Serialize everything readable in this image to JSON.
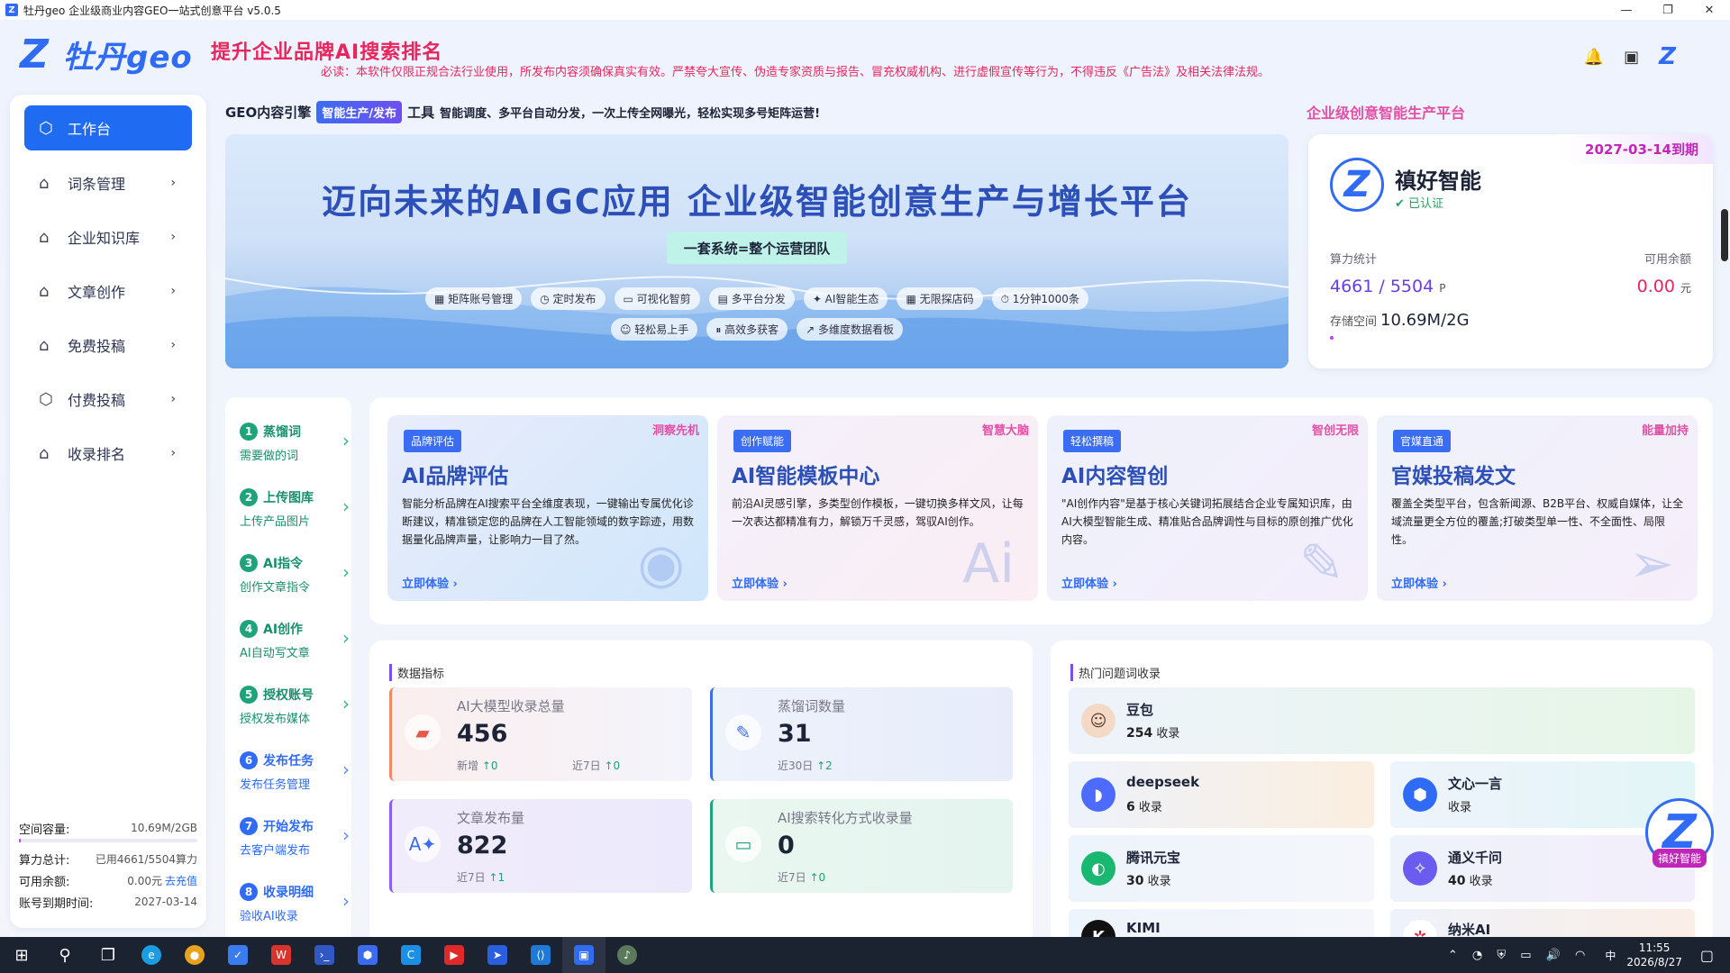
{
  "window": {
    "title": "牡丹geo 企业级商业内容GEO一站式创意平台 v5.0.5",
    "controls": [
      "—",
      "❐",
      "✕"
    ]
  },
  "header": {
    "logo_text": "牡丹geo",
    "slogan": "提升企业品牌AI搜索排名",
    "notice": "必读：本软件仅限正规合法行业使用，所发布内容须确保真实有效。严禁夸大宣传、伪造专家资质与报告、冒充权威机构、进行虚假宣传等行为，不得违反《广告法》及相关法律法规。"
  },
  "sidebar": {
    "items": [
      {
        "label": "工作台",
        "icon": "hexagon-icon"
      },
      {
        "label": "词条管理",
        "icon": "home-icon"
      },
      {
        "label": "企业知识库",
        "icon": "home-icon"
      },
      {
        "label": "文章创作",
        "icon": "home-icon"
      },
      {
        "label": "免费投稿",
        "icon": "home-icon"
      },
      {
        "label": "付费投稿",
        "icon": "hexagon-icon"
      },
      {
        "label": "收录排名",
        "icon": "home-icon"
      }
    ],
    "stats": {
      "space_label": "空间容量:",
      "space_value": "10.69M/2GB",
      "compute_label": "算力总计:",
      "compute_value": "已用4661/5504算力",
      "balance_label": "可用余额:",
      "balance_value": "0.00元",
      "recharge": "去充值",
      "expire_label": "账号到期时间:",
      "expire_value": "2027-03-14"
    }
  },
  "geo": {
    "prefix": "GEO内容引擎",
    "badge": "智能生产/发布",
    "tool": "工具",
    "desc": "智能调度、多平台自动分发，一次上传全网曝光，轻松实现多号矩阵运营!",
    "right_slogan": "企业级创意智能生产平台"
  },
  "banner": {
    "title": "迈向未来的AIGC应用  企业级智能创意生产与增长平台",
    "subtitle": "一套系统=整个运营团队",
    "chips_row1": [
      "▦ 矩阵账号管理",
      "◷ 定时发布",
      "▭ 可视化智剪",
      "▤ 多平台分发",
      "✦ AI智能生态",
      "▦ 无限探店码",
      "⏱ 1分钟1000条"
    ],
    "chips_row2": [
      "☺ 轻松易上手",
      "⏸ 高效多获客",
      "↗ 多维度数据看板"
    ]
  },
  "account": {
    "expire": "2027-03-14到期",
    "name": "禛好智能",
    "verified": "已认证",
    "compute_label": "算力统计",
    "balance_label": "可用余额",
    "compute_value": "4661 / 5504",
    "compute_unit": "P",
    "balance_value": "0.00",
    "balance_unit": "元",
    "storage_label": "存储空间",
    "storage_value": "10.69M/2G"
  },
  "steps": [
    {
      "no": "1",
      "title": "蒸馏词",
      "sub": "需要做的词"
    },
    {
      "no": "2",
      "title": "上传图库",
      "sub": "上传产品图片"
    },
    {
      "no": "3",
      "title": "AI指令",
      "sub": "创作文章指令"
    },
    {
      "no": "4",
      "title": "AI创作",
      "sub": "AI自动写文章"
    },
    {
      "no": "5",
      "title": "授权账号",
      "sub": "授权发布媒体"
    },
    {
      "no": "6",
      "title": "发布任务",
      "sub": "发布任务管理"
    },
    {
      "no": "7",
      "title": "开始发布",
      "sub": "去客户端发布"
    },
    {
      "no": "8",
      "title": "收录明细",
      "sub": "验收AI收录"
    }
  ],
  "features": [
    {
      "tag": "品牌评估",
      "corner": "洞察先机",
      "title": "AI品牌评估",
      "desc": "智能分析品牌在AI搜索平台全维度表现，一键输出专属优化诊断建议，精准锁定您的品牌在人工智能领域的数字踪迹，用数据量化品牌声量，让影响力一目了然。",
      "try": "立即体验 ›",
      "icon": "eye-icon"
    },
    {
      "tag": "创作赋能",
      "corner": "智慧大脑",
      "title": "AI智能模板中心",
      "desc": "前沿AI灵感引擎，多类型创作模板，一键切换多样文风，让每一次表达都精准有力，解锁万千灵感，驾驭AI创作。",
      "try": "立即体验 ›",
      "icon": "ai-head-icon"
    },
    {
      "tag": "轻松撰稿",
      "corner": "智创无限",
      "title": "AI内容智创",
      "desc": "\"AI创作内容\"是基于核心关键词拓展结合企业专属知识库，由AI大模型智能生成、精准贴合品牌调性与目标的原创推广优化内容。",
      "try": "立即体验 ›",
      "icon": "edit-icon"
    },
    {
      "tag": "官媒直通",
      "corner": "能量加持",
      "title": "官媒投稿发文",
      "desc": "覆盖全类型平台，包含新闻源、B2B平台、权威自媒体，让全域流量更全方位的覆盖;打破类型单一性、不全面性、局限性。",
      "try": "立即体验 ›",
      "icon": "send-icon"
    }
  ],
  "data_panel": {
    "title": "数据指标",
    "cards": [
      {
        "label": "AI大模型收录总量",
        "value": "456",
        "sub1": "新增",
        "sub1v": "↑0",
        "sub2": "近7日",
        "sub2v": "↑0"
      },
      {
        "label": "蒸馏词数量",
        "value": "31",
        "sub1": "近30日",
        "sub1v": "↑2",
        "sub2": "",
        "sub2v": ""
      },
      {
        "label": "文章发布量",
        "value": "822",
        "sub1": "近7日",
        "sub1v": "↑1",
        "sub2": "",
        "sub2v": ""
      },
      {
        "label": "AI搜索转化方式收录量",
        "value": "0",
        "sub1": "近7日",
        "sub1v": "↑0",
        "sub2": "",
        "sub2v": ""
      }
    ]
  },
  "hot_panel": {
    "title": "热门问题词收录",
    "suffix": "收录",
    "items": [
      {
        "name": "豆包",
        "count": "254"
      },
      {
        "name": "deepseek",
        "count": "6"
      },
      {
        "name": "文心一言",
        "count": ""
      },
      {
        "name": "腾讯元宝",
        "count": "30"
      },
      {
        "name": "通义千问",
        "count": "40"
      },
      {
        "name": "KIMI",
        "count": ""
      },
      {
        "name": "纳米AI",
        "count": ""
      }
    ]
  },
  "float": {
    "tag": "禛好智能"
  },
  "taskbar": {
    "time": "11:55",
    "date": "2026/8/27",
    "ime": "中"
  }
}
